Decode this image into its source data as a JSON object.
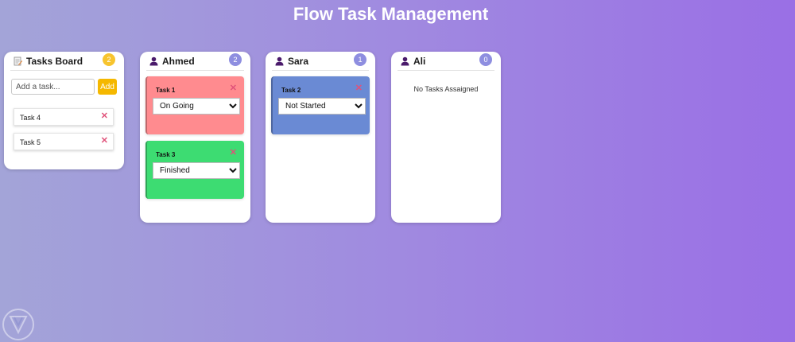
{
  "app": {
    "title": "Flow Task Management"
  },
  "colors": {
    "board_badge": "#f7c42e",
    "member_badge": "#8e8ee0",
    "add_button": "#f5b800",
    "remove_icon": "#e0527a",
    "user_icon": "#4a1a6b",
    "on_going": "#ff8b8f",
    "finished": "#3ddc72",
    "not_started": "#6a8ad4"
  },
  "board": {
    "title": "Tasks Board",
    "icon": "notepad-icon",
    "count": "2",
    "input_placeholder": "Add a task...",
    "add_label": "Add",
    "items": [
      {
        "label": "Task 4"
      },
      {
        "label": "Task 5"
      }
    ]
  },
  "status_options": [
    "Not Started",
    "On Going",
    "Finished"
  ],
  "members": [
    {
      "name": "Ahmed",
      "icon": "user-icon",
      "count": "2",
      "tasks": [
        {
          "label": "Task 1",
          "status": "On Going"
        },
        {
          "label": "Task 3",
          "status": "Finished"
        }
      ]
    },
    {
      "name": "Sara",
      "icon": "user-icon",
      "count": "1",
      "tasks": [
        {
          "label": "Task 2",
          "status": "Not Started"
        }
      ]
    },
    {
      "name": "Ali",
      "icon": "user-icon",
      "count": "0",
      "empty_text": "No Tasks Assaigned",
      "tasks": []
    }
  ]
}
